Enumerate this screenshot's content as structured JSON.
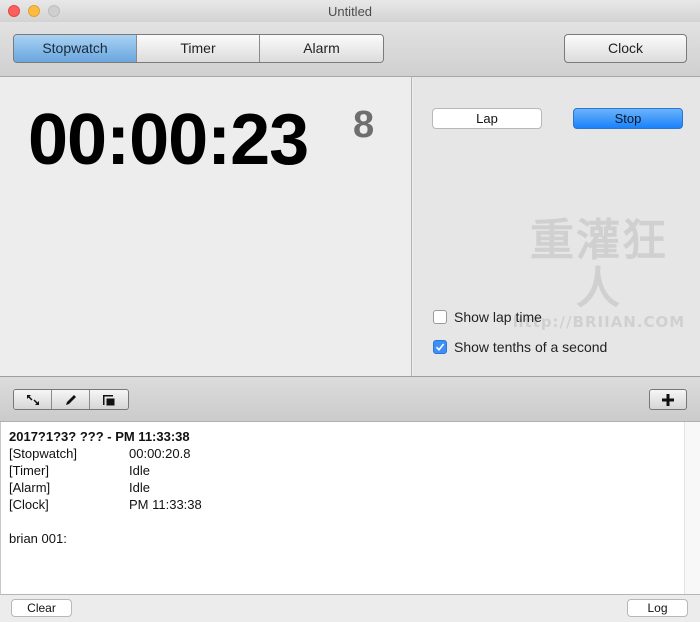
{
  "window": {
    "title": "Untitled"
  },
  "mode_tabs": [
    {
      "label": "Stopwatch",
      "active": true
    },
    {
      "label": "Timer",
      "active": false
    },
    {
      "label": "Alarm",
      "active": false
    }
  ],
  "clock_button": "Clock",
  "stopwatch": {
    "time": "00:00:23",
    "tenths": "8"
  },
  "controls": {
    "lap_label": "Lap",
    "stop_label": "Stop",
    "accent_color": "#1a82fb"
  },
  "watermark": {
    "main": "重灌狂人",
    "url": "http://BRIIAN.COM"
  },
  "options": [
    {
      "label": "Show lap time",
      "checked": false
    },
    {
      "label": "Show tenths of a second",
      "checked": true
    }
  ],
  "log_toolbar": {
    "icons": [
      "resize-icon",
      "pencil-icon",
      "window-icon"
    ],
    "add_label": "+"
  },
  "log": {
    "header": "2017?1?3? ??? - PM  11:33:38",
    "rows": [
      {
        "key": "[Stopwatch]",
        "value": "00:00:20.8"
      },
      {
        "key": "[Timer]",
        "value": "Idle"
      },
      {
        "key": "[Alarm]",
        "value": "Idle"
      },
      {
        "key": "[Clock]",
        "value": "PM  11:33:38"
      }
    ],
    "note": "brian 001:"
  },
  "footer": {
    "clear_label": "Clear",
    "log_label": "Log"
  }
}
